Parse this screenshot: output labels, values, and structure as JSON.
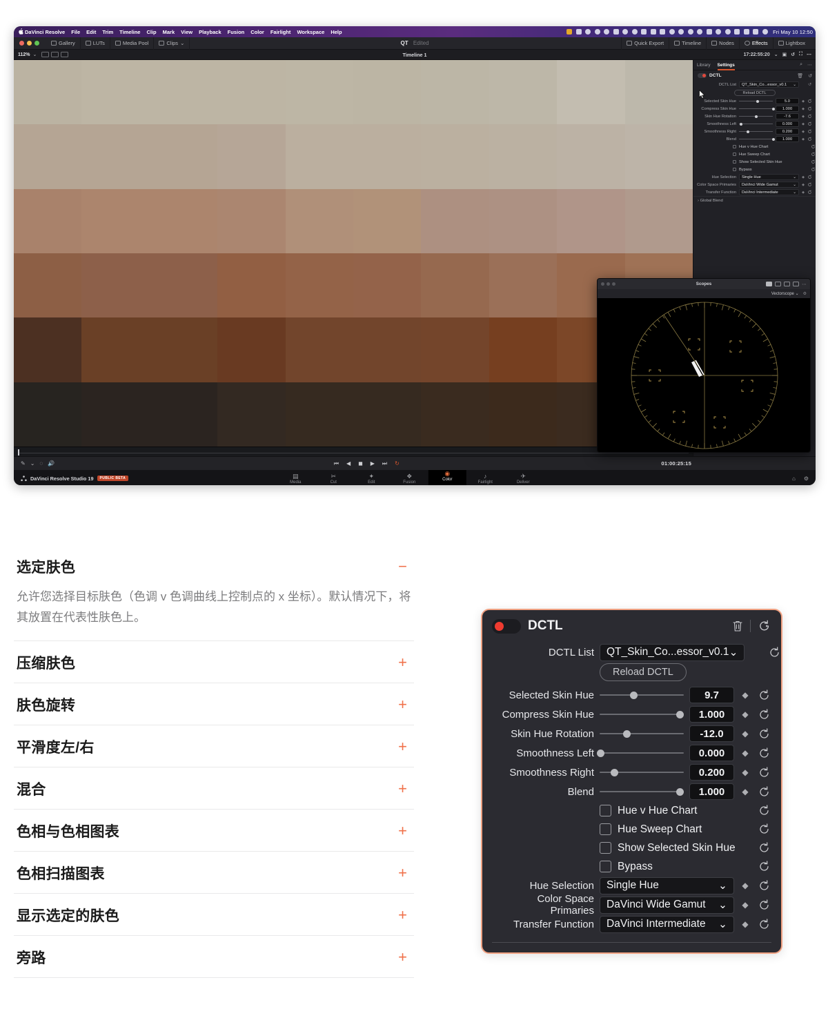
{
  "macos_menubar": {
    "app_name": "DaVinci Resolve",
    "menus": [
      "File",
      "Edit",
      "Trim",
      "Timeline",
      "Clip",
      "Mark",
      "View",
      "Playback",
      "Fusion",
      "Color",
      "Fairlight",
      "Workspace",
      "Help"
    ],
    "clock": "Fri May 10  12:50"
  },
  "resolve_toolbar": {
    "left_buttons": [
      "Gallery",
      "LUTs",
      "Media Pool",
      "Clips"
    ],
    "project_title": "QT",
    "project_state": "Edited",
    "right_buttons": [
      "Quick Export",
      "Timeline",
      "Nodes",
      "Effects",
      "Lightbox"
    ],
    "active_right_button": "Effects"
  },
  "viewer_header": {
    "zoom": "112%",
    "timeline_name": "Timeline 1",
    "timecode": "17:22:55:20"
  },
  "transport": {
    "timecode": "01:00:25:15"
  },
  "pages_bar": {
    "product": "DaVinci Resolve Studio 19",
    "badge": "PUBLIC BETA",
    "pages": [
      "Media",
      "Cut",
      "Edit",
      "Fusion",
      "Color",
      "Fairlight",
      "Deliver"
    ],
    "active_page": "Color"
  },
  "inspector": {
    "tabs": [
      "Library",
      "Settings"
    ],
    "active_tab": "Settings",
    "effect_title": "DCTL",
    "dctl_list_label": "DCTL List",
    "dctl_list_value": "QT_Skin_Co...essor_v0.1",
    "reload_button": "Reload DCTL",
    "sliders": [
      {
        "label": "Selected Skin Hue",
        "value": "5.0",
        "pos": 52
      },
      {
        "label": "Compress Skin Hue",
        "value": "1.000",
        "pos": 97
      },
      {
        "label": "Skin Hue Rotation",
        "value": "-7.6",
        "pos": 47
      },
      {
        "label": "Smoothness Left",
        "value": "0.000",
        "pos": 2
      },
      {
        "label": "Smoothness Right",
        "value": "0.200",
        "pos": 22
      },
      {
        "label": "Blend",
        "value": "1.000",
        "pos": 97
      }
    ],
    "checkboxes": [
      "Hue v Hue Chart",
      "Hue Sweep Chart",
      "Show Selected Skin Hue",
      "Bypass"
    ],
    "dropdowns": [
      {
        "label": "Hue Selection",
        "value": "Single Hue"
      },
      {
        "label": "Color Space Primaries",
        "value": "DaVinci Wide Gamut"
      },
      {
        "label": "Transfer Function",
        "value": "DaVinci Intermediate"
      }
    ],
    "global_blend": "Global Blend"
  },
  "scopes_window": {
    "title": "Scopes",
    "scope_type": "Vectorscope"
  },
  "skin_chart": {
    "rows": [
      [
        "#bbb3a2",
        "#bdb5a4",
        "#bdb5a4",
        "#bdb5a4",
        "#bdb6a5",
        "#bcb5a4",
        "#bcb6a6",
        "#bdb7a8",
        "#c3bdb0",
        "#bdb8ab"
      ],
      [
        "#b5a594",
        "#b5a594",
        "#b5a594",
        "#b6a697",
        "#bbaf9f",
        "#bbaf9f",
        "#bbb0a0",
        "#bbb1a2",
        "#bcb2a5",
        "#bdb4a8"
      ],
      [
        "#a9826b",
        "#ac856d",
        "#ac856d",
        "#ab8670",
        "#b09079",
        "#b19279",
        "#ad9081",
        "#ad9183",
        "#b09589",
        "#b09a8d"
      ],
      [
        "#8d5f45",
        "#8d604a",
        "#8d604a",
        "#925f43",
        "#946348",
        "#94634a",
        "#96694f",
        "#9b7058",
        "#9a6a4e",
        "#9f7256"
      ],
      [
        "#4c3022",
        "#6a4026",
        "#6a4026",
        "#693a22",
        "#72452c",
        "#72452c",
        "#74452b",
        "#763f20",
        "#7c4728",
        "#7c4e30"
      ],
      [
        "#272420",
        "#2b2420",
        "#2b2420",
        "#332922",
        "#362a20",
        "#362a20",
        "#3a2b1f",
        "#3c2a1c",
        "#3b2b1f",
        "#3d2f23"
      ]
    ]
  },
  "doc": {
    "accordion": [
      {
        "title": "选定肤色",
        "sign": "−",
        "open": true,
        "body": "允许您选择目标肤色（色调 v 色调曲线上控制点的 x 坐标）。默认情况下，将其放置在代表性肤色上。"
      },
      {
        "title": "压缩肤色",
        "sign": "+",
        "open": false,
        "body": ""
      },
      {
        "title": "肤色旋转",
        "sign": "+",
        "open": false,
        "body": ""
      },
      {
        "title": "平滑度左/右",
        "sign": "+",
        "open": false,
        "body": ""
      },
      {
        "title": "混合",
        "sign": "+",
        "open": false,
        "body": ""
      },
      {
        "title": "色相与色相图表",
        "sign": "+",
        "open": false,
        "body": ""
      },
      {
        "title": "色相扫描图表",
        "sign": "+",
        "open": false,
        "body": ""
      },
      {
        "title": "显示选定的肤色",
        "sign": "+",
        "open": false,
        "body": ""
      },
      {
        "title": "旁路",
        "sign": "+",
        "open": false,
        "body": ""
      }
    ]
  },
  "big_panel": {
    "title": "DCTL",
    "dctl_list_label": "DCTL List",
    "dctl_list_value": "QT_Skin_Co...essor_v0.1",
    "reload_button": "Reload DCTL",
    "sliders": [
      {
        "label": "Selected Skin Hue",
        "value": "9.7",
        "pos": 40
      },
      {
        "label": "Compress Skin Hue",
        "value": "1.000",
        "pos": 95
      },
      {
        "label": "Skin Hue Rotation",
        "value": "-12.0",
        "pos": 32
      },
      {
        "label": "Smoothness Left",
        "value": "0.000",
        "pos": 1
      },
      {
        "label": "Smoothness Right",
        "value": "0.200",
        "pos": 17
      },
      {
        "label": "Blend",
        "value": "1.000",
        "pos": 95
      }
    ],
    "checkboxes": [
      "Hue v Hue Chart",
      "Hue Sweep Chart",
      "Show Selected Skin Hue",
      "Bypass"
    ],
    "dropdowns": [
      {
        "label": "Hue Selection",
        "value": "Single Hue"
      },
      {
        "label": "Color Space Primaries",
        "value": "DaVinci Wide Gamut"
      },
      {
        "label": "Transfer Function",
        "value": "DaVinci Intermediate"
      }
    ],
    "accent_color": "#f0a182"
  }
}
